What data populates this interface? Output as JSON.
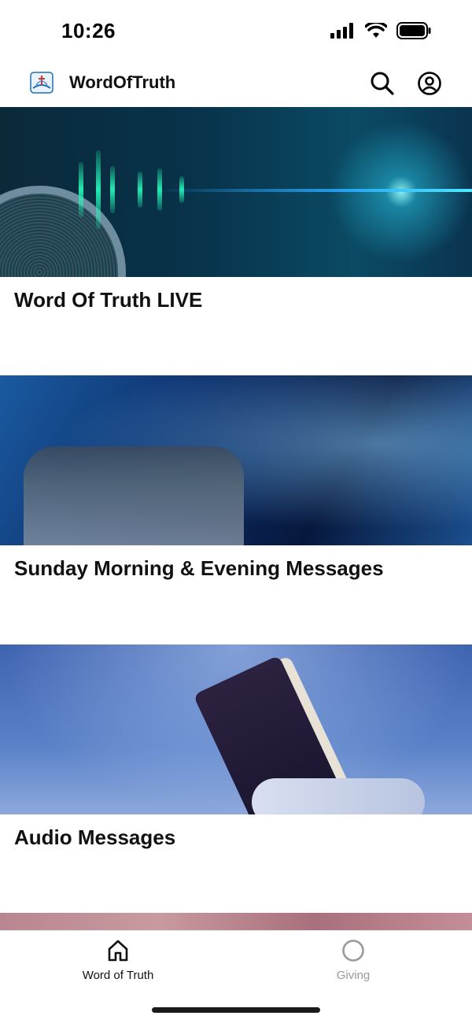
{
  "status_bar": {
    "time": "10:26"
  },
  "header": {
    "app_title": "WordOfTruth",
    "logo_icon": "church-logo-icon",
    "search_icon": "search-icon",
    "profile_icon": "user-circle-icon"
  },
  "feed": {
    "cards": [
      {
        "title": "Word Of Truth LIVE",
        "image": "live-stream-waveform-image"
      },
      {
        "title": "Sunday Morning & Evening Messages",
        "image": "congregation-worship-image"
      },
      {
        "title": "Audio Messages",
        "image": "holy-bible-image"
      },
      {
        "title": "",
        "image": "partial-next-card-image"
      }
    ]
  },
  "tab_bar": {
    "tabs": [
      {
        "label": "Word of Truth",
        "icon": "home-icon",
        "active": true
      },
      {
        "label": "Giving",
        "icon": "circle-icon",
        "active": false
      }
    ],
    "active_color": "#111111",
    "inactive_color": "#9a9a9a"
  }
}
